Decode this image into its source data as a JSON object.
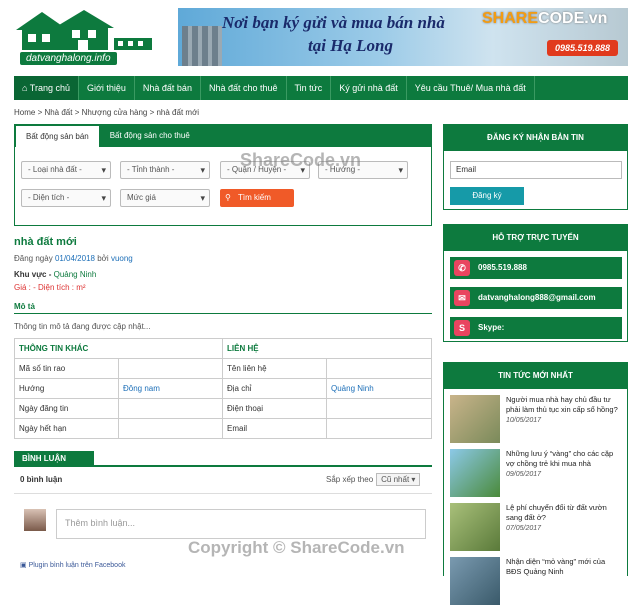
{
  "header": {
    "site_name": "datvanghalong.info",
    "banner_line1": "Nơi bạn ký gửi và mua bán nhà",
    "banner_line2": "tại Hạ Long",
    "banner_phone": "0985.519.888",
    "watermark_a": "SHARE",
    "watermark_b": "CODE.vn"
  },
  "nav": [
    "Trang chủ",
    "Giới thiệu",
    "Nhà đất bán",
    "Nhà đất cho thuê",
    "Tin tức",
    "Ký gửi nhà đất",
    "Yêu cầu Thuê/ Mua nhà đất"
  ],
  "breadcrumb": "Home > Nhà đất > Nhượng cửa hàng > nhà đất mới",
  "search": {
    "tab_sale": "Bất động sản bán",
    "tab_rent": "Bất động sản cho thuê",
    "type": "- Loại nhà đất -",
    "province": "- Tỉnh thành -",
    "district": "- Quận / Huyện -",
    "direction": "- Hướng -",
    "area": "- Diện tích -",
    "price": "Mức giá",
    "button": "Tìm kiếm"
  },
  "watermark_mid": "ShareCode.vn",
  "listing": {
    "title": "nhà đất mới",
    "posted_prefix": "Đăng ngày",
    "posted_date": "01/04/2018",
    "by": "bởi",
    "author": "vuong",
    "area_label": "Khu vực -",
    "area_value": "Quảng Ninh",
    "price_line": "Giá : - Diện tích : m²",
    "desc_heading": "Mô tả",
    "desc": "Thông tin mô tả đang được cập nhật..."
  },
  "info_table": {
    "left_header": "THÔNG TIN KHÁC",
    "right_header": "LIÊN HỆ",
    "rows": [
      {
        "l1": "Mã số tin rao",
        "v1": "",
        "l2": "Tên liên hệ",
        "v2": ""
      },
      {
        "l1": "Hướng",
        "v1": "Đông nam",
        "l2": "Địa chỉ",
        "v2": "Quảng Ninh"
      },
      {
        "l1": "Ngày đăng tin",
        "v1": "",
        "l2": "Điện thoại",
        "v2": ""
      },
      {
        "l1": "Ngày hết hạn",
        "v1": "",
        "l2": "Email",
        "v2": ""
      }
    ]
  },
  "comments": {
    "header": "BÌNH LUẬN",
    "count": "0 bình luận",
    "sort_label": "Sắp xếp theo",
    "sort_value": "Cũ nhất",
    "placeholder": "Thêm bình luận...",
    "plugin": "Plugin bình luận trên Facebook"
  },
  "watermark_bottom": "Copyright © ShareCode.vn",
  "sidebar": {
    "subscribe_title": "ĐĂNG KÝ NHẬN BẢN TIN",
    "email_value": "Email",
    "subscribe_button": "Đăng ký",
    "support_title": "HỖ TRỢ TRỰC TUYẾN",
    "phone": "0985.519.888",
    "email": "datvanghalong888@gmail.com",
    "skype": "Skype:",
    "news_title": "TIN TỨC MỚI NHẤT",
    "news": [
      {
        "title": "Người mua nhà hay chủ đầu tư phải làm thủ tục xin cấp sổ hồng?",
        "date": "10/05/2017"
      },
      {
        "title": "Những lưu ý “vàng” cho các cặp vợ chồng trẻ khi mua nhà",
        "date": "09/05/2017"
      },
      {
        "title": "Lệ phí chuyển đổi từ đất vườn sang đất ở?",
        "date": "07/05/2017"
      },
      {
        "title": "Nhận diện “mỏ vàng” mới của BĐS Quảng Ninh",
        "date": ""
      }
    ]
  },
  "colors": {
    "primary": "#0d7a3e",
    "accent": "#f05a28",
    "link": "#1d6fb8"
  }
}
